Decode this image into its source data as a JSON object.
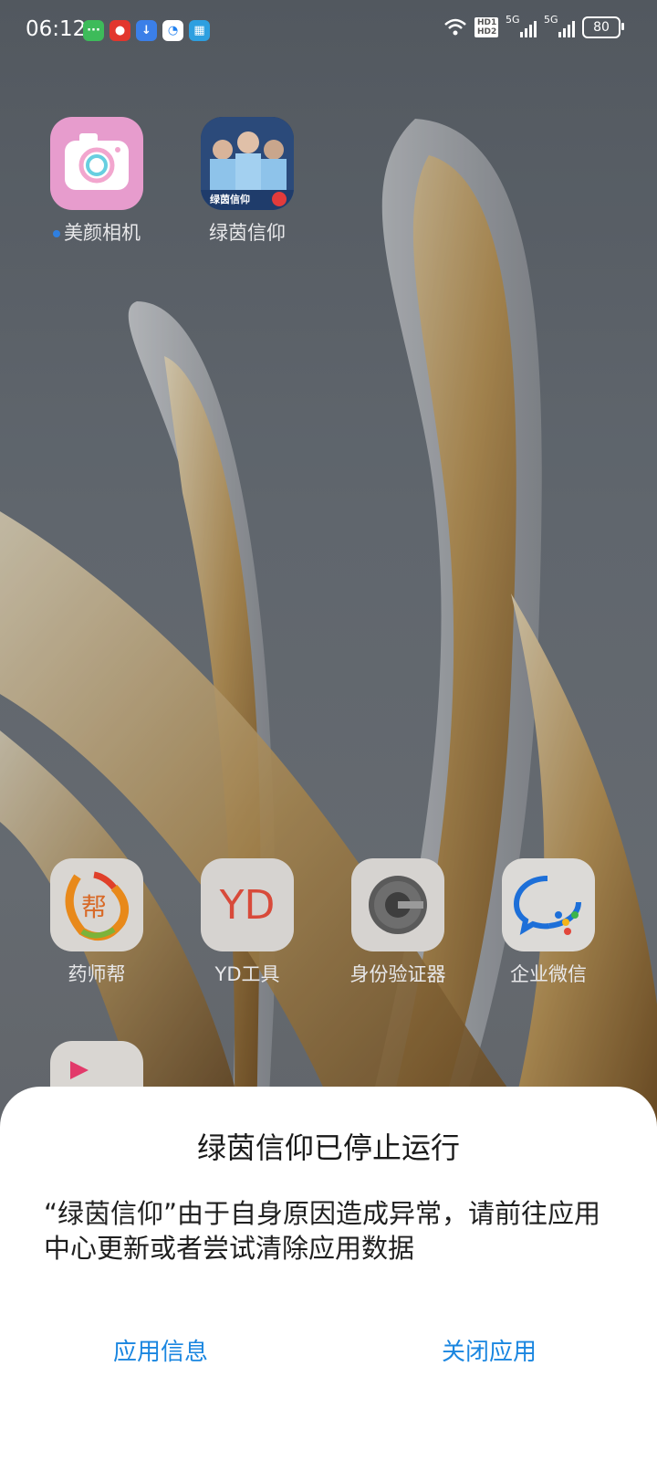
{
  "status_bar": {
    "time": "06:12",
    "notification_icons": [
      "message-icon",
      "news-icon",
      "download-icon",
      "browser-icon",
      "grid-icon"
    ],
    "network_badge_top": "HD1",
    "network_badge_bottom": "HD2",
    "sim1_label": "5G",
    "sim2_label": "5G",
    "battery": "80"
  },
  "home_screen": {
    "row1": [
      {
        "label": "美颜相机",
        "has_new_dot": true
      },
      {
        "label": "绿茵信仰",
        "icon_text": "绿茵信仰"
      }
    ],
    "row2": [
      {
        "label": "药师帮",
        "icon_text": "帮"
      },
      {
        "label": "YD工具",
        "icon_text": "YD"
      },
      {
        "label": "身份验证器"
      },
      {
        "label": "企业微信"
      }
    ]
  },
  "dialog": {
    "title": "绿茵信仰已停止运行",
    "message": "“绿茵信仰”由于自身原因造成异常，请前往应用中心更新或者尝试清除应用数据",
    "left_button": "应用信息",
    "right_button": "关闭应用"
  },
  "colors": {
    "accent": "#1a86e0",
    "dialog_bg": "#ffffff"
  }
}
